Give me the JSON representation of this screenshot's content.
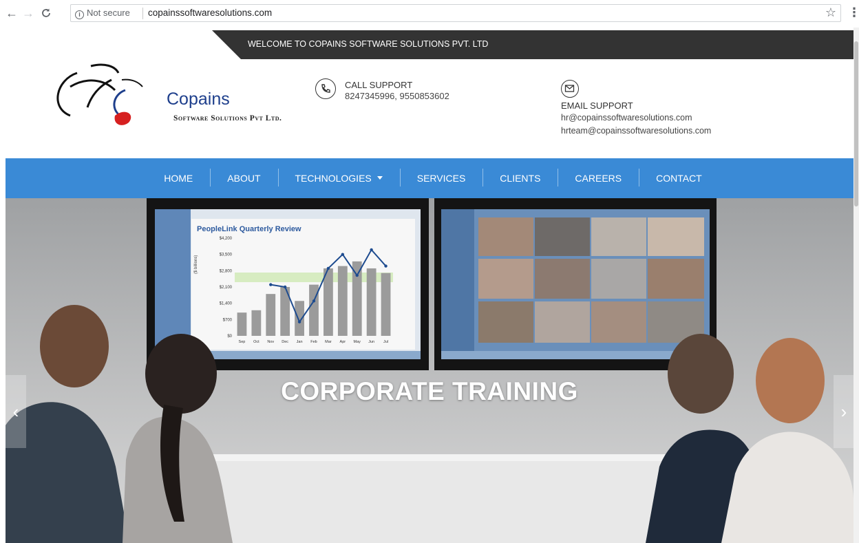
{
  "browser": {
    "back_icon": "back-arrow-icon",
    "forward_icon": "forward-arrow-icon",
    "reload_icon": "reload-icon",
    "security_label": "Not secure",
    "url": "copainssoftwaresolutions.com",
    "bookmark_icon": "star-icon",
    "menu_icon": "kebab-menu-icon"
  },
  "topbar": {
    "welcome": "WELCOME TO COPAINS SOFTWARE SOLUTIONS PVT. LTD"
  },
  "logo": {
    "name": "Copains",
    "subtitle": "Software Solutions Pvt Ltd."
  },
  "contact": {
    "call_title": "CALL SUPPORT",
    "call_numbers": "8247345996, 9550853602",
    "email_title": "EMAIL SUPPORT",
    "email_1": "hr@copainssoftwaresolutions.com",
    "email_2": "hrteam@copainssoftwaresolutions.com"
  },
  "nav": {
    "items": [
      {
        "label": "HOME"
      },
      {
        "label": "ABOUT"
      },
      {
        "label": "TECHNOLOGIES",
        "dropdown": true
      },
      {
        "label": "SERVICES"
      },
      {
        "label": "CLIENTS"
      },
      {
        "label": "CAREERS"
      },
      {
        "label": "CONTACT"
      }
    ],
    "color": "#3a8ad6"
  },
  "hero": {
    "caption": "CORPORATE TRAINING",
    "screen_chart_title": "PeopleLink Quarterly Review",
    "screen_y_ticks": [
      "$4,200",
      "$3,500",
      "$2,800",
      "$2,100",
      "$1,400",
      "$700",
      "$0"
    ],
    "screen_y_label": "($ billions)",
    "screen_x_ticks": [
      "Sep",
      "Oct",
      "Nov",
      "Dec",
      "Jan",
      "Feb",
      "Mar",
      "Apr",
      "May",
      "Jun",
      "Jul"
    ],
    "screen_bar_values": [
      1000,
      1100,
      1800,
      2100,
      1500,
      2200,
      2900,
      3000,
      3200,
      2900,
      2700
    ],
    "screen_line_values": [
      null,
      null,
      2200,
      2100,
      600,
      1500,
      2900,
      3500,
      2600,
      3700,
      3000
    ],
    "prev_label": "‹",
    "next_label": "›"
  }
}
